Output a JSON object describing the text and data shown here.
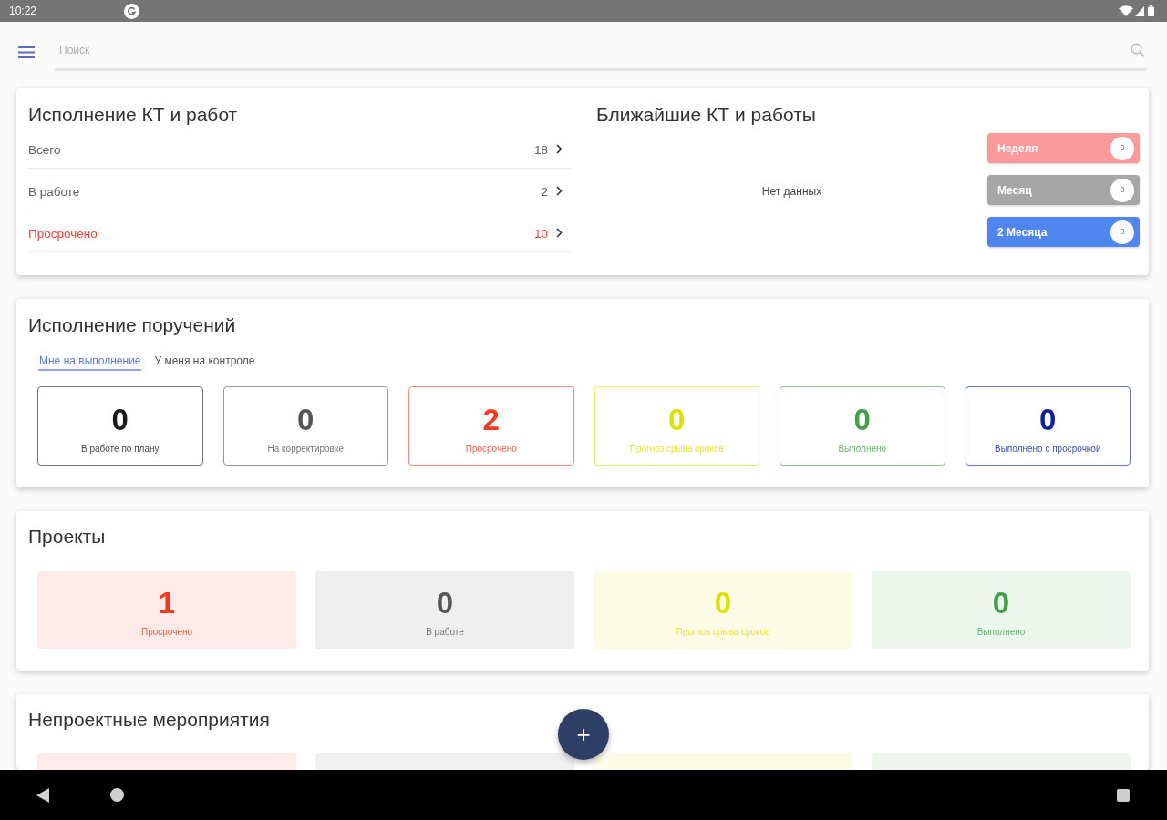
{
  "status_bar": {
    "time": "10:22"
  },
  "search": {
    "placeholder": "Поиск"
  },
  "kt_execution": {
    "title": "Исполнение КТ и работ",
    "rows": [
      {
        "label": "Всего",
        "value": "18",
        "color": "#616161"
      },
      {
        "label": "В работе",
        "value": "2",
        "color": "#616161"
      },
      {
        "label": "Просрочено",
        "value": "10",
        "color": "#f44336"
      }
    ]
  },
  "upcoming": {
    "title": "Ближайшие КТ и работы",
    "empty_text": "Нет данных",
    "periods": [
      {
        "label": "Неделя",
        "count": "0",
        "color": "#fa9a9a"
      },
      {
        "label": "Месяц",
        "count": "0",
        "color": "#a6a6a6"
      },
      {
        "label": "2 Месяца",
        "count": "0",
        "color": "#4f86f0"
      }
    ]
  },
  "assignments": {
    "title": "Исполнение поручений",
    "tabs": [
      {
        "label": "Мне на выполнение",
        "selected": true
      },
      {
        "label": "У меня на контроле",
        "selected": false
      }
    ],
    "tiles": [
      {
        "count": "0",
        "label": "В работе по плану",
        "color": "#1a1a1a"
      },
      {
        "count": "0",
        "label": "На корректировке",
        "color": "#555555"
      },
      {
        "count": "2",
        "label": "Просрочено",
        "color": "#f03a24"
      },
      {
        "count": "0",
        "label": "Прогноз срыва сроков",
        "color": "#dde000"
      },
      {
        "count": "0",
        "label": "Выполнено",
        "color": "#43a047"
      },
      {
        "count": "0",
        "label": "Выполнено с просрочкой",
        "color": "#0d1f9e"
      }
    ]
  },
  "projects": {
    "title": "Проекты",
    "tiles": [
      {
        "count": "1",
        "label": "Просрочено",
        "color": "#f03a24"
      },
      {
        "count": "0",
        "label": "В работе",
        "color": "#555555"
      },
      {
        "count": "0",
        "label": "Прогноз срыва сроков",
        "color": "#dde000"
      },
      {
        "count": "0",
        "label": "Выполнено",
        "color": "#43a047"
      }
    ]
  },
  "non_project": {
    "title": "Непроектные мероприятия",
    "tiles": [
      {
        "color": "#fdeaea"
      },
      {
        "color": "#f0f0f0"
      },
      {
        "color": "#fdfde6"
      },
      {
        "color": "#eef6ee"
      }
    ]
  },
  "fab": {
    "label": "+"
  }
}
